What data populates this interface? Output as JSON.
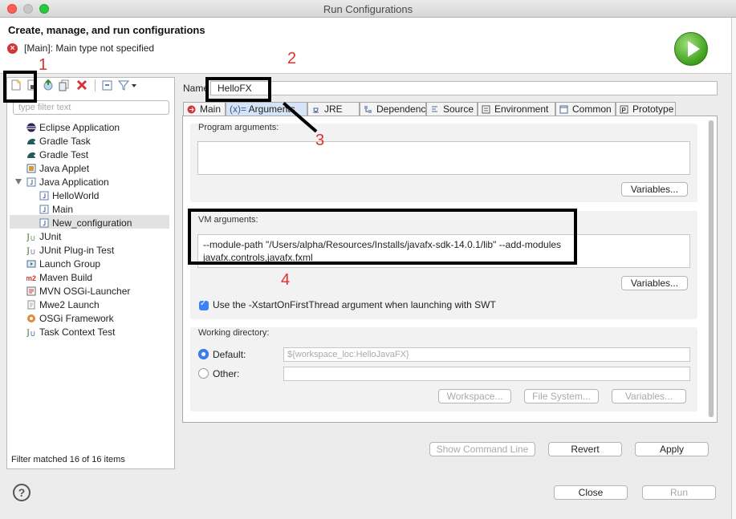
{
  "window": {
    "title": "Run Configurations",
    "colors": {
      "close": "#fe5f57",
      "minimize": "#febc2e",
      "maximize": "#28c840"
    }
  },
  "header": {
    "title": "Create, manage, and run configurations",
    "error_message": "[Main]: Main type not specified",
    "error_icon_glyph": "×",
    "run_icon": "run-icon"
  },
  "left_panel": {
    "filter_placeholder": "type filter text",
    "toolbar": [
      "new-config-icon",
      "new-prototype-icon",
      "export-icon",
      "duplicate-icon",
      "delete-icon",
      "collapse-all-icon",
      "filter-icon"
    ],
    "tree": [
      {
        "label": "Eclipse Application",
        "icon": "eclipse-icon",
        "level": 0
      },
      {
        "label": "Gradle Task",
        "icon": "gradle-icon",
        "level": 0
      },
      {
        "label": "Gradle Test",
        "icon": "gradle-icon",
        "level": 0
      },
      {
        "label": "Java Applet",
        "icon": "applet-icon",
        "level": 0
      },
      {
        "label": "Java Application",
        "icon": "java-app-icon",
        "level": 0,
        "expanded": true
      },
      {
        "label": "HelloWorld",
        "icon": "java-app-icon",
        "level": 1
      },
      {
        "label": "Main",
        "icon": "java-app-icon",
        "level": 1
      },
      {
        "label": "New_configuration",
        "icon": "java-app-icon",
        "level": 1,
        "selected": true
      },
      {
        "label": "JUnit",
        "icon": "junit-icon",
        "level": 0
      },
      {
        "label": "JUnit Plug-in Test",
        "icon": "junit-plugin-icon",
        "level": 0
      },
      {
        "label": "Launch Group",
        "icon": "launch-group-icon",
        "level": 0
      },
      {
        "label": "Maven Build",
        "icon": "maven-icon",
        "level": 0
      },
      {
        "label": "MVN OSGi-Launcher",
        "icon": "osgi-launcher-icon",
        "level": 0
      },
      {
        "label": "Mwe2 Launch",
        "icon": "mwe2-icon",
        "level": 0
      },
      {
        "label": "OSGi Framework",
        "icon": "osgi-icon",
        "level": 0
      },
      {
        "label": "Task Context Test",
        "icon": "task-context-icon",
        "level": 0
      }
    ],
    "filter_status": "Filter matched 16 of 16 items"
  },
  "config": {
    "name_label": "Name",
    "name_value": "HelloFX",
    "tabs": [
      {
        "label": "Main",
        "icon": "main-tab-icon"
      },
      {
        "label": "Arguments",
        "icon": "arguments-tab-icon",
        "active": true,
        "prefix": "(x)="
      },
      {
        "label": "JRE",
        "icon": "jre-tab-icon"
      },
      {
        "label": "Dependencies",
        "icon": "dependencies-tab-icon"
      },
      {
        "label": "Source",
        "icon": "source-tab-icon"
      },
      {
        "label": "Environment",
        "icon": "environment-tab-icon"
      },
      {
        "label": "Common",
        "icon": "common-tab-icon"
      },
      {
        "label": "Prototype",
        "icon": "prototype-tab-icon"
      }
    ],
    "program_args_label": "Program arguments:",
    "program_args_value": "",
    "variables_label": "Variables...",
    "vm_args_label": "VM arguments:",
    "vm_args_line1": "--module-path \"/Users/alpha/Resources/Installs/javafx-sdk-14.0.1/lib\" --add-modules",
    "vm_args_line2": "javafx.controls,javafx.fxml",
    "xstart_label": "Use the -XstartOnFirstThread argument when launching with SWT",
    "xstart_checked": true,
    "working_dir_label": "Working directory:",
    "default_label": "Default:",
    "default_value": "${workspace_loc:HelloJavaFX}",
    "other_label": "Other:",
    "other_value": "",
    "workspace_btn": "Workspace...",
    "filesystem_btn": "File System...",
    "variables_btn": "Variables..."
  },
  "actions": {
    "show_command_line": "Show Command Line",
    "revert": "Revert",
    "apply": "Apply",
    "close": "Close",
    "run": "Run"
  },
  "annotations": [
    "1",
    "2",
    "3",
    "4"
  ]
}
